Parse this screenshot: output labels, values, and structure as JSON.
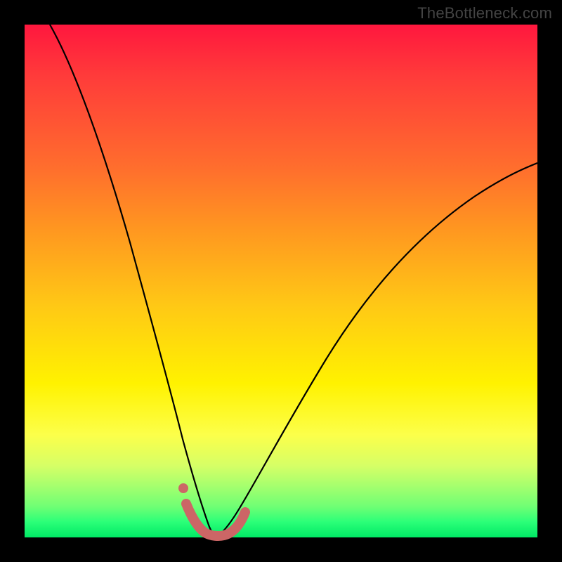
{
  "watermark": "TheBottleneck.com",
  "colors": {
    "background": "#000000",
    "watermark_text": "#444444",
    "curve_stroke": "#000000",
    "marker": "#cc6666",
    "gradient_stops": [
      "#ff173e",
      "#ff3b3a",
      "#ff6e2d",
      "#ff9720",
      "#ffc915",
      "#fff200",
      "#fcff4a",
      "#d6ff66",
      "#a5ff6e",
      "#6fff74",
      "#2bff78",
      "#00e965"
    ]
  },
  "chart_data": {
    "type": "line",
    "title": "",
    "xlabel": "",
    "ylabel": "",
    "xlim": [
      0,
      100
    ],
    "ylim": [
      0,
      100
    ],
    "grid": false,
    "legend": false,
    "series": [
      {
        "name": "left_branch",
        "x": [
          5,
          9,
          13,
          17,
          20,
          23,
          26,
          28,
          30,
          31.5,
          33,
          34,
          35,
          36,
          37
        ],
        "y": [
          100,
          87,
          75,
          63,
          53,
          43,
          33,
          25,
          17,
          11,
          6.5,
          4,
          2,
          1,
          0.5
        ]
      },
      {
        "name": "right_branch",
        "x": [
          37,
          38.5,
          40,
          42,
          45,
          50,
          56,
          63,
          72,
          82,
          92,
          100
        ],
        "y": [
          0.5,
          1,
          2.5,
          5,
          10,
          18,
          28,
          38,
          49,
          59,
          67,
          73
        ]
      },
      {
        "name": "bottom_marker",
        "x": [
          31.5,
          33,
          34.5,
          35.5,
          36.5,
          37.5,
          38.5,
          39.5,
          40.5,
          42,
          43
        ],
        "y": [
          7,
          3,
          1.5,
          1,
          0.8,
          0.8,
          0.9,
          1.2,
          1.8,
          3.5,
          6
        ]
      },
      {
        "name": "marker_dot",
        "x": [
          31
        ],
        "y": [
          10
        ]
      }
    ],
    "annotations": []
  }
}
